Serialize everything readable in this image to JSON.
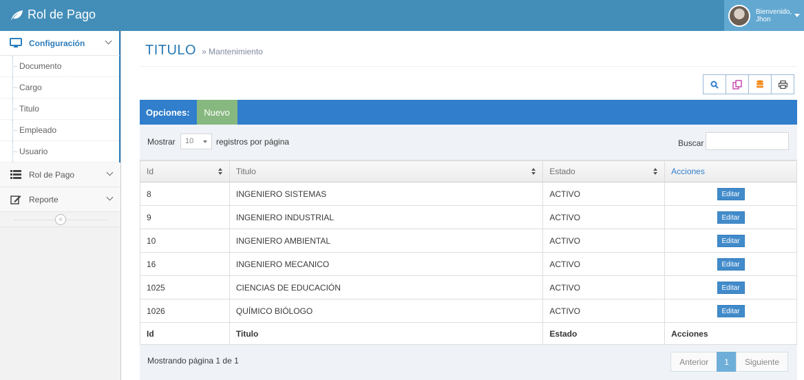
{
  "brand": {
    "title": "Rol de Pago",
    "icon": "leaf-icon"
  },
  "user": {
    "greeting": "Bienvenido,",
    "name": "Jhon"
  },
  "sidebar": {
    "menus": [
      {
        "label": "Configuración",
        "icon": "desktop-icon",
        "active": true,
        "items": [
          "Documento",
          "Cargo",
          "Titulo",
          "Empleado",
          "Usuario"
        ]
      },
      {
        "label": "Rol de Pago",
        "icon": "list-icon"
      },
      {
        "label": "Reporte",
        "icon": "edit-icon"
      }
    ],
    "collapse_glyph": "«"
  },
  "header": {
    "title": "TITULO",
    "subtitle": "» Mantenimiento"
  },
  "toolbar": {
    "buttons": [
      "search-icon",
      "copy-icon",
      "database-icon",
      "print-icon"
    ]
  },
  "options": {
    "label": "Opciones:",
    "new_button": "Nuevo"
  },
  "datatable": {
    "show_label": "Mostrar",
    "page_length": "10",
    "per_page_label": "registros por página",
    "search_label": "Buscar",
    "columns": [
      "Id",
      "Titulo",
      "Estado",
      "Acciones"
    ],
    "rows": [
      {
        "id": "8",
        "titulo": "INGENIERO SISTEMAS",
        "estado": "ACTIVO",
        "accion": "Editar"
      },
      {
        "id": "9",
        "titulo": "INGENIERO INDUSTRIAL",
        "estado": "ACTIVO",
        "accion": "Editar"
      },
      {
        "id": "10",
        "titulo": "INGENIERO AMBIENTAL",
        "estado": "ACTIVO",
        "accion": "Editar"
      },
      {
        "id": "16",
        "titulo": "INGENIERO MECANICO",
        "estado": "ACTIVO",
        "accion": "Editar"
      },
      {
        "id": "1025",
        "titulo": "CIENCIAS DE EDUCACIÓN",
        "estado": "ACTIVO",
        "accion": "Editar"
      },
      {
        "id": "1026",
        "titulo": "QUÍMICO BIÓLOGO",
        "estado": "ACTIVO",
        "accion": "Editar"
      }
    ],
    "info": "Mostrando página 1 de 1",
    "pagination": {
      "prev": "Anterior",
      "current": "1",
      "next": "Siguiente"
    }
  },
  "colors": {
    "navbar": "#438eb9",
    "accent": "#307ecc",
    "new_button": "#87b87f",
    "edit_button": "#428bca"
  }
}
